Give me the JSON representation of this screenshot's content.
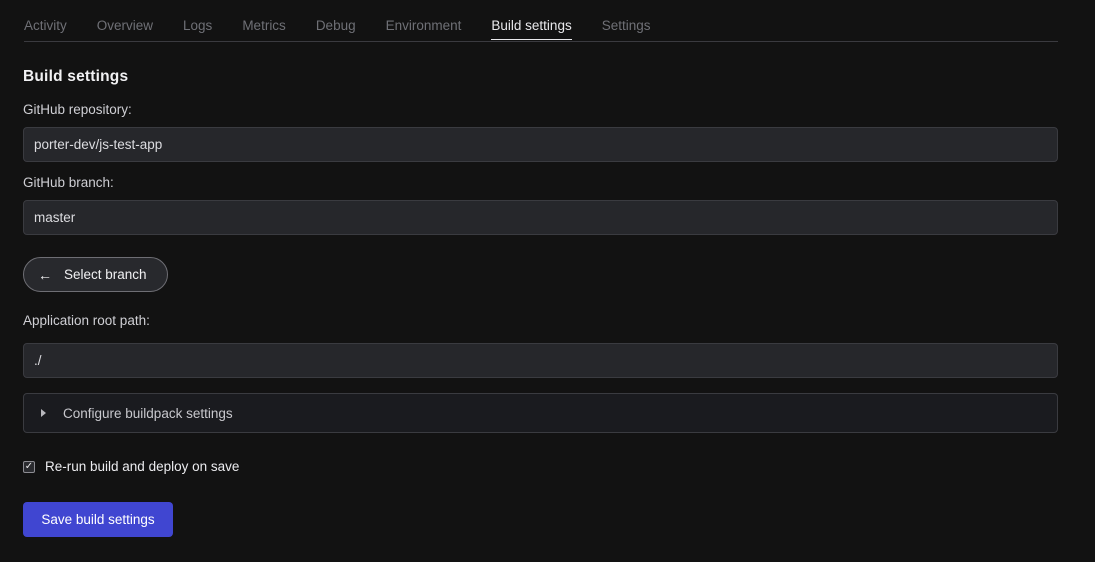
{
  "tabs": [
    {
      "label": "Activity",
      "active": false
    },
    {
      "label": "Overview",
      "active": false
    },
    {
      "label": "Logs",
      "active": false
    },
    {
      "label": "Metrics",
      "active": false
    },
    {
      "label": "Debug",
      "active": false
    },
    {
      "label": "Environment",
      "active": false
    },
    {
      "label": "Build settings",
      "active": true
    },
    {
      "label": "Settings",
      "active": false
    }
  ],
  "page_title": "Build settings",
  "repo": {
    "label": "GitHub repository:",
    "value": "porter-dev/js-test-app"
  },
  "branch": {
    "label": "GitHub branch:",
    "value": "master"
  },
  "select_branch": {
    "label": "Select branch",
    "icon": "arrow-left-icon"
  },
  "root_path": {
    "label": "Application root path:",
    "value": "./"
  },
  "buildpack": {
    "label": "Configure buildpack settings",
    "icon": "caret-right-icon"
  },
  "rerun": {
    "label": "Re-run build and deploy on save",
    "checked": true
  },
  "save_button": {
    "label": "Save build settings"
  },
  "colors": {
    "accent": "#4046d1",
    "background": "#121212"
  }
}
